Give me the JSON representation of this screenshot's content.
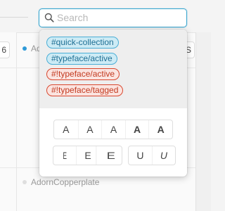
{
  "search": {
    "placeholder": "Search",
    "value": ""
  },
  "background": {
    "left_chip": "6",
    "right_chip": "S",
    "list_item_1": "Adorn",
    "list_item_2": "AdornCopperplate"
  },
  "tags": [
    {
      "label": "#quick-collection",
      "color": "blue"
    },
    {
      "label": "#typeface/active",
      "color": "blue"
    },
    {
      "label": "#!typeface/active",
      "color": "red"
    },
    {
      "label": "#!typeface/tagged",
      "color": "red"
    }
  ],
  "weight_buttons": [
    "A",
    "A",
    "A",
    "A",
    "A"
  ],
  "width_buttons": [
    "E",
    "E",
    "E"
  ],
  "style_buttons": [
    "U",
    "U"
  ],
  "colors": {
    "accent": "#3aa6cf",
    "tag_blue": "#4aaed6",
    "tag_red": "#d9472e"
  }
}
